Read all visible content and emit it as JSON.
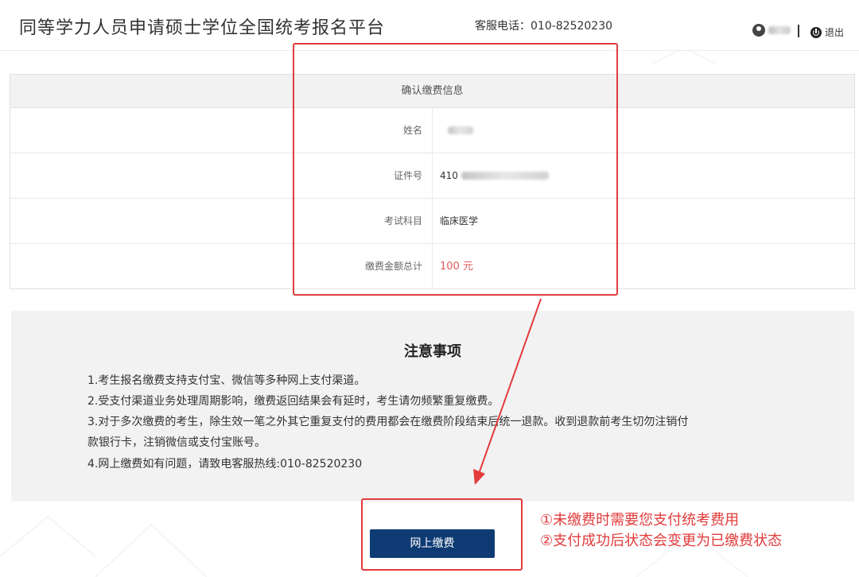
{
  "header": {
    "title": "同等学力人员申请硕士学位全国统考报名平台",
    "hotline": "客服电话：010-82520230",
    "logout_label": "退出"
  },
  "payment_info": {
    "caption": "确认缴费信息",
    "rows": [
      {
        "label": "姓名",
        "value": ""
      },
      {
        "label": "证件号",
        "value": "410"
      },
      {
        "label": "考试科目",
        "value": "临床医学"
      },
      {
        "label": "缴费金额总计",
        "value": "100 元"
      }
    ]
  },
  "notice": {
    "title": "注意事项",
    "items": [
      "1.考生报名缴费支持支付宝、微信等多种网上支付渠道。",
      "2.受支付渠道业务处理周期影响，缴费返回结果会有延时，考生请勿频繁重复缴费。",
      "3.对于多次缴费的考生，除生效一笔之外其它重复支付的费用都会在缴费阶段结束后统一退款。收到退款前考生切勿注销付",
      "款银行卡，注销微信或支付宝账号。",
      "4.网上缴费如有问题，请致电客服热线:010-82520230"
    ]
  },
  "pay_button_label": "网上缴费",
  "annotations": {
    "line1": "①未缴费时需要您支付统考费用",
    "line2": "②支付成功后状态会变更为已缴费状态",
    "color": "#e23b3b"
  },
  "colors": {
    "button": "#0f3b74",
    "amount": "#e05a5a",
    "panel": "#f2f2f2"
  }
}
